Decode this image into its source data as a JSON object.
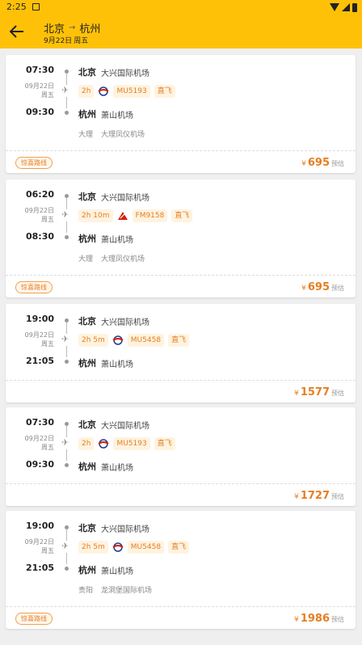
{
  "status_bar": {
    "time": "2:25"
  },
  "header": {
    "from": "北京",
    "arrow": "→",
    "to": "杭州",
    "date": "9月22日",
    "weekday": "周五"
  },
  "colors": {
    "accent": "#ffc107",
    "price": "#e67e22"
  },
  "flights": [
    {
      "dep_time": "07:30",
      "date": "09月22日",
      "weekday": "周五",
      "arr_time": "09:30",
      "from_city": "北京",
      "from_airport": "大兴国际机场",
      "to_city": "杭州",
      "to_airport": "萧山机场",
      "duration": "2h",
      "airline_logo": "china-eastern-logo",
      "flight_no": "MU5193",
      "direct": "直飞",
      "transit_city": "大理",
      "transit_airport": "大理凤仪机场",
      "tag": "惊喜路线",
      "currency": "¥",
      "price": "695",
      "price_note": "预估"
    },
    {
      "dep_time": "06:20",
      "date": "09月22日",
      "weekday": "周五",
      "arr_time": "08:30",
      "from_city": "北京",
      "from_airport": "大兴国际机场",
      "to_city": "杭州",
      "to_airport": "萧山机场",
      "duration": "2h 10m",
      "airline_logo": "shanghai-airlines-logo",
      "flight_no": "FM9158",
      "direct": "直飞",
      "transit_city": "大理",
      "transit_airport": "大理凤仪机场",
      "tag": "惊喜路线",
      "currency": "¥",
      "price": "695",
      "price_note": "预估"
    },
    {
      "dep_time": "19:00",
      "date": "09月22日",
      "weekday": "周五",
      "arr_time": "21:05",
      "from_city": "北京",
      "from_airport": "大兴国际机场",
      "to_city": "杭州",
      "to_airport": "萧山机场",
      "duration": "2h 5m",
      "airline_logo": "china-eastern-logo",
      "flight_no": "MU5458",
      "direct": "直飞",
      "currency": "¥",
      "price": "1577",
      "price_note": "预估"
    },
    {
      "dep_time": "07:30",
      "date": "09月22日",
      "weekday": "周五",
      "arr_time": "09:30",
      "from_city": "北京",
      "from_airport": "大兴国际机场",
      "to_city": "杭州",
      "to_airport": "萧山机场",
      "duration": "2h",
      "airline_logo": "china-eastern-logo",
      "flight_no": "MU5193",
      "direct": "直飞",
      "currency": "¥",
      "price": "1727",
      "price_note": "预估"
    },
    {
      "dep_time": "19:00",
      "date": "09月22日",
      "weekday": "周五",
      "arr_time": "21:05",
      "from_city": "北京",
      "from_airport": "大兴国际机场",
      "to_city": "杭州",
      "to_airport": "萧山机场",
      "duration": "2h 5m",
      "airline_logo": "china-eastern-logo",
      "flight_no": "MU5458",
      "direct": "直飞",
      "transit_city": "贵阳",
      "transit_airport": "龙洞堡国际机场",
      "tag": "惊喜路线",
      "currency": "¥",
      "price": "1986",
      "price_note": "预估"
    }
  ]
}
